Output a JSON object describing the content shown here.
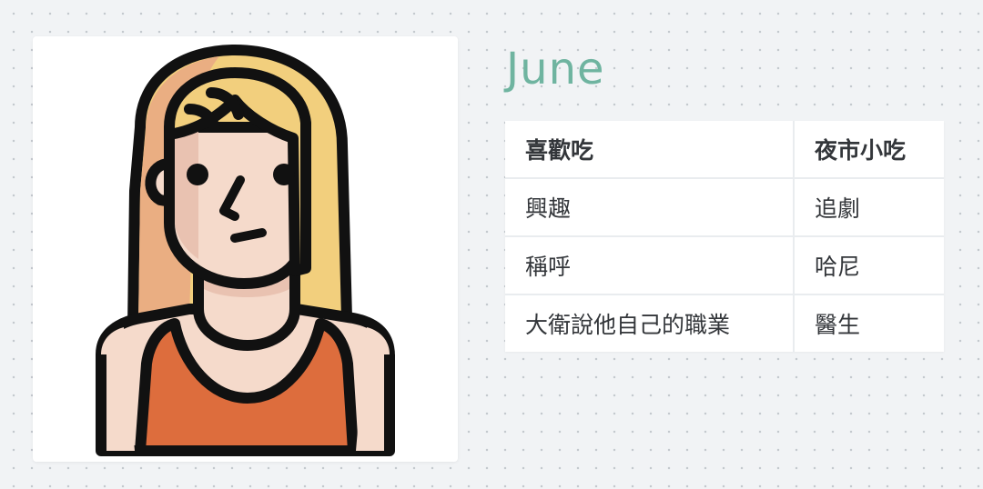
{
  "profile": {
    "name": "June",
    "avatar_icon": "woman-long-blonde-hair-avatar-icon",
    "colors": {
      "name_accent": "#6fb4a0",
      "hair_light": "#f2cf7d",
      "hair_shadow": "#eaae82",
      "skin": "#f5dacb",
      "skin_shadow": "#e9c2b1",
      "top": "#dd6d3d",
      "outline": "#111111"
    }
  },
  "table": {
    "rows": [
      {
        "key": "喜歡吃",
        "value": "夜市小吃",
        "bold": true
      },
      {
        "key": "興趣",
        "value": "追劇"
      },
      {
        "key": "稱呼",
        "value": "哈尼"
      },
      {
        "key": "大衛說他自己的職業",
        "value": "醫生"
      }
    ]
  }
}
